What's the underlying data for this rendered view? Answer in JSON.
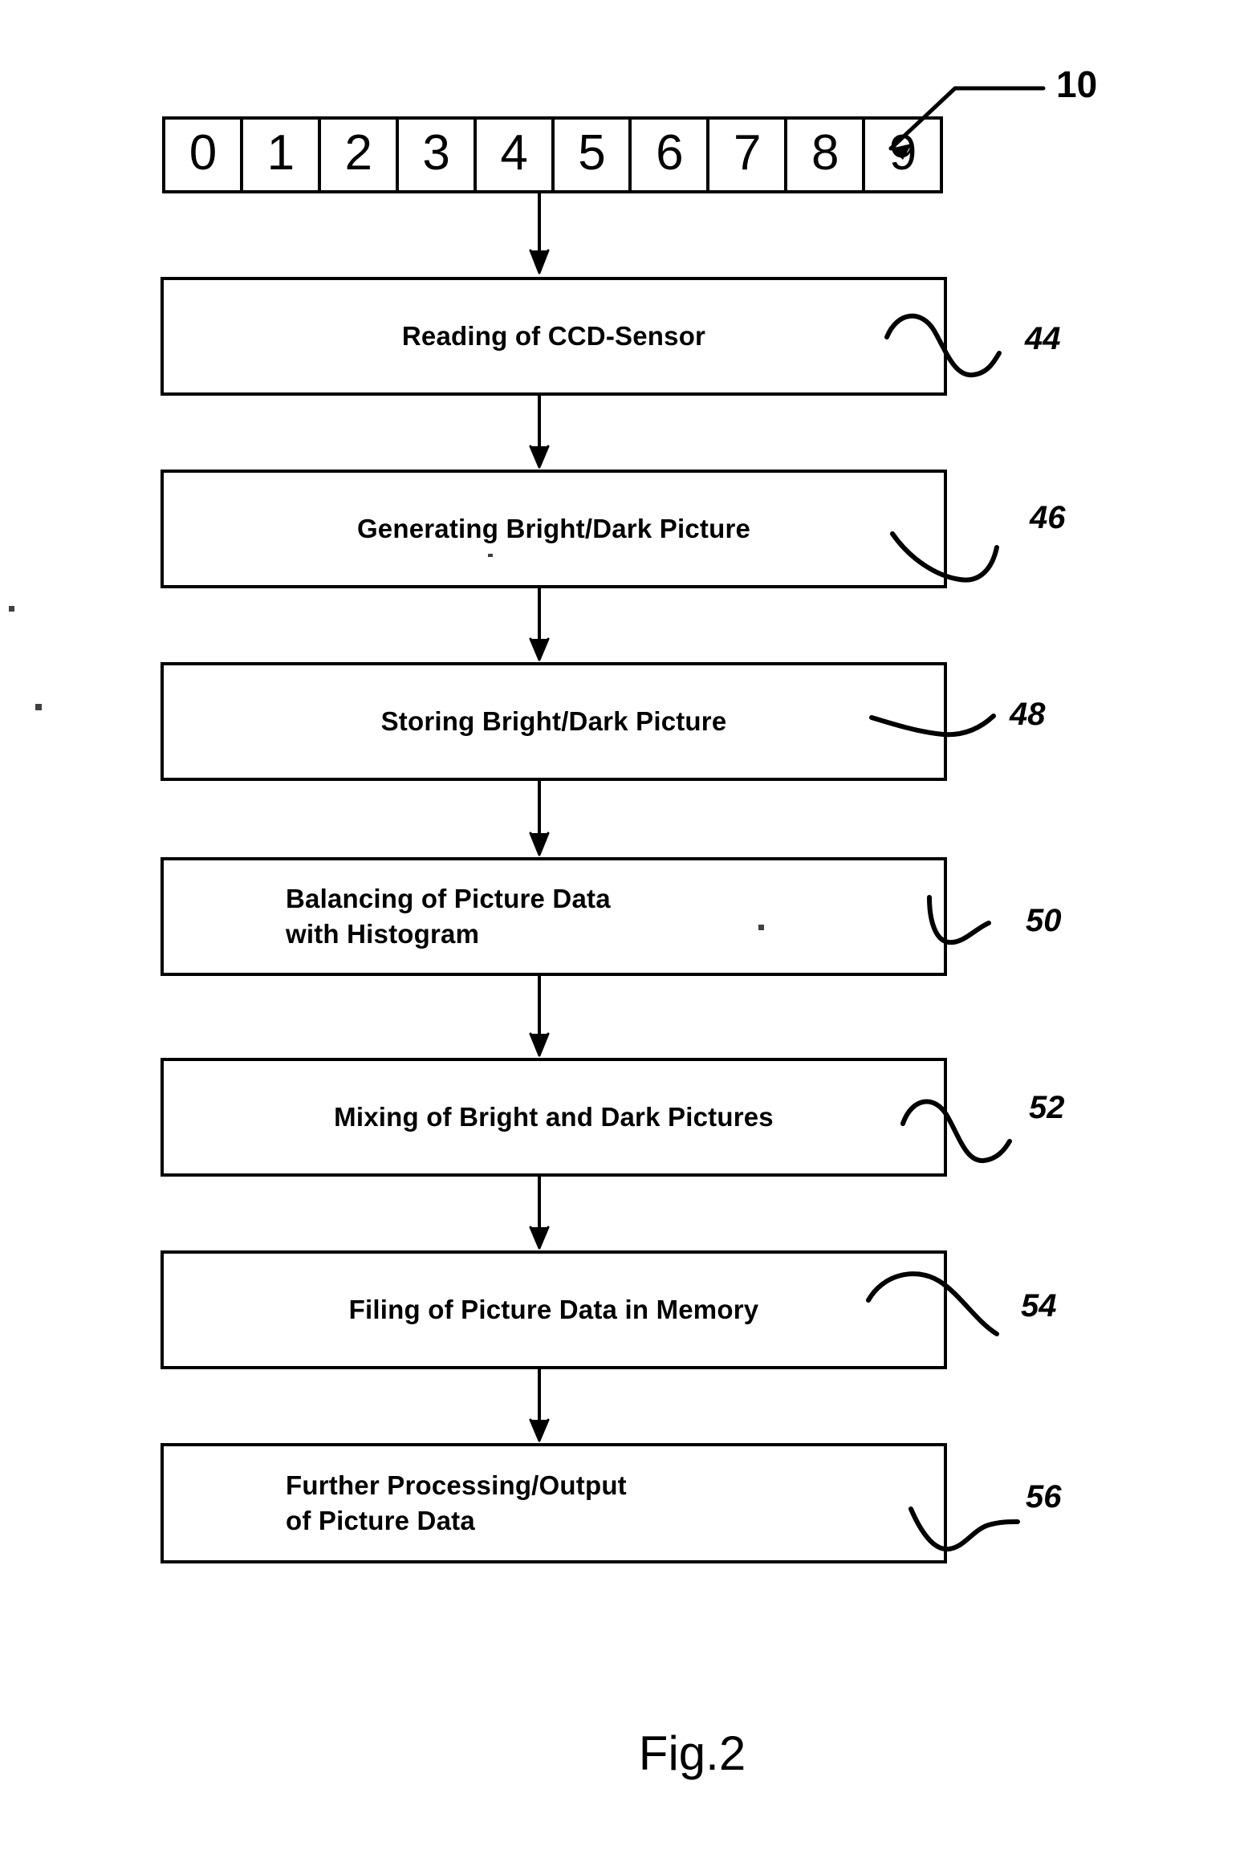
{
  "figure": {
    "caption": "Fig.2",
    "sensor_strip": {
      "ref": "10",
      "cells": [
        "0",
        "1",
        "2",
        "3",
        "4",
        "5",
        "6",
        "7",
        "8",
        "9"
      ]
    },
    "steps": [
      {
        "ref": "44",
        "line1": "Reading of CCD-Sensor",
        "line2": "",
        "align": "center"
      },
      {
        "ref": "46",
        "line1": "Generating Bright/Dark Picture",
        "line2": "",
        "align": "center"
      },
      {
        "ref": "48",
        "line1": "Storing Bright/Dark Picture",
        "line2": "",
        "align": "center"
      },
      {
        "ref": "50",
        "line1": "Balancing of Picture Data",
        "line2": "with Histogram",
        "align": "left"
      },
      {
        "ref": "52",
        "line1": "Mixing of Bright and Dark Pictures",
        "line2": "",
        "align": "center"
      },
      {
        "ref": "54",
        "line1": "Filing of Picture Data in Memory",
        "line2": "",
        "align": "center"
      },
      {
        "ref": "56",
        "line1": "Further Processing/Output",
        "line2": "of Picture Data",
        "align": "left"
      }
    ],
    "colors": {
      "ink": "#000000",
      "paper": "#ffffff"
    }
  }
}
